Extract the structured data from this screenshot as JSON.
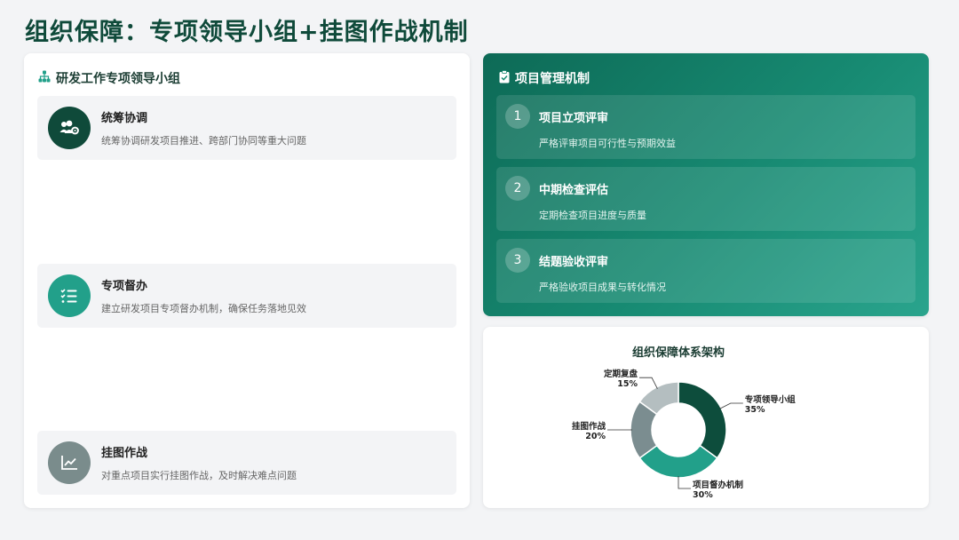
{
  "page": {
    "title": "组织保障：专项领导小组+挂图作战机制"
  },
  "left_panel": {
    "title": "研发工作专项领导小组",
    "items": [
      {
        "title": "统筹协调",
        "desc": "统筹协调研发项目推进、跨部门协同等重大问题",
        "icon": "users-gear-icon",
        "color": "#0f4a3a"
      },
      {
        "title": "专项督办",
        "desc": "建立研发项目专项督办机制，确保任务落地见效",
        "icon": "list-check-icon",
        "color": "#22a08a"
      },
      {
        "title": "挂图作战",
        "desc": "对重点项目实行挂图作战，及时解决难点问题",
        "icon": "chart-line-icon",
        "color": "#7a8c8c"
      }
    ]
  },
  "mechanism_panel": {
    "title": "项目管理机制",
    "items": [
      {
        "num": "1",
        "title": "项目立项评审",
        "desc": "严格评审项目可行性与预期效益"
      },
      {
        "num": "2",
        "title": "中期检查评估",
        "desc": "定期检查项目进度与质量"
      },
      {
        "num": "3",
        "title": "结题验收评审",
        "desc": "严格验收项目成果与转化情况"
      }
    ]
  },
  "chart_data": {
    "type": "pie",
    "title": "组织保障体系架构",
    "categories": [
      "专项领导小组",
      "项目督办机制",
      "挂图作战",
      "定期复盘"
    ],
    "values": [
      35,
      30,
      20,
      15
    ],
    "value_labels": [
      "35%",
      "30%",
      "20%",
      "15%"
    ],
    "colors": [
      "#0d4d3c",
      "#22a08a",
      "#7b8d90",
      "#b4bec0"
    ]
  }
}
